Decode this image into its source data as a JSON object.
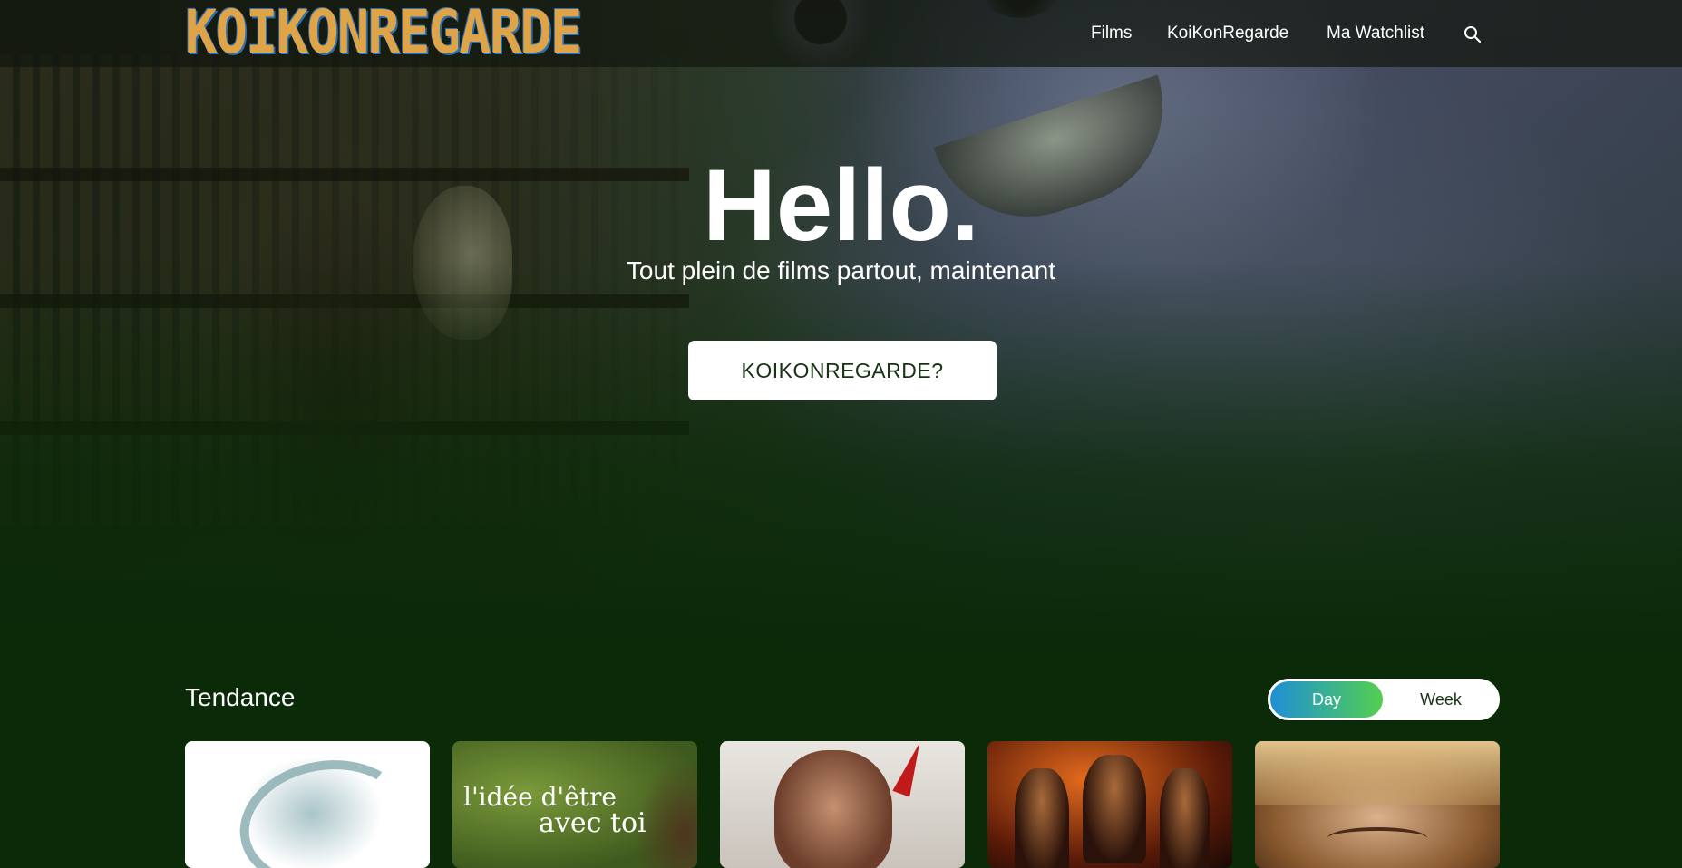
{
  "header": {
    "logo_text": "KOIKONREGARDE",
    "nav": [
      "Films",
      "KoiKonRegarde",
      "Ma Watchlist"
    ],
    "search_icon": "search-icon"
  },
  "hero": {
    "title": "Hello.",
    "subtitle": "Tout plein de films partout, maintenant",
    "cta_label": "KOIKONREGARDE?"
  },
  "trending": {
    "title": "Tendance",
    "toggle": {
      "options": [
        "Day",
        "Week"
      ],
      "selected": "Day"
    },
    "cards": [
      {
        "poster_text": ""
      },
      {
        "poster_text": "l'idée d'être",
        "poster_text_2": "avec toi"
      },
      {
        "poster_text": ""
      },
      {
        "poster_text": ""
      },
      {
        "poster_text": ""
      }
    ]
  },
  "colors": {
    "background": "#0b2a08",
    "logo_orange": "#e0a448",
    "logo_blue": "#2a6fb0",
    "toggle_gradient_start": "#1f8fd6",
    "toggle_gradient_end": "#53cf4f",
    "cta_text": "#173314"
  }
}
